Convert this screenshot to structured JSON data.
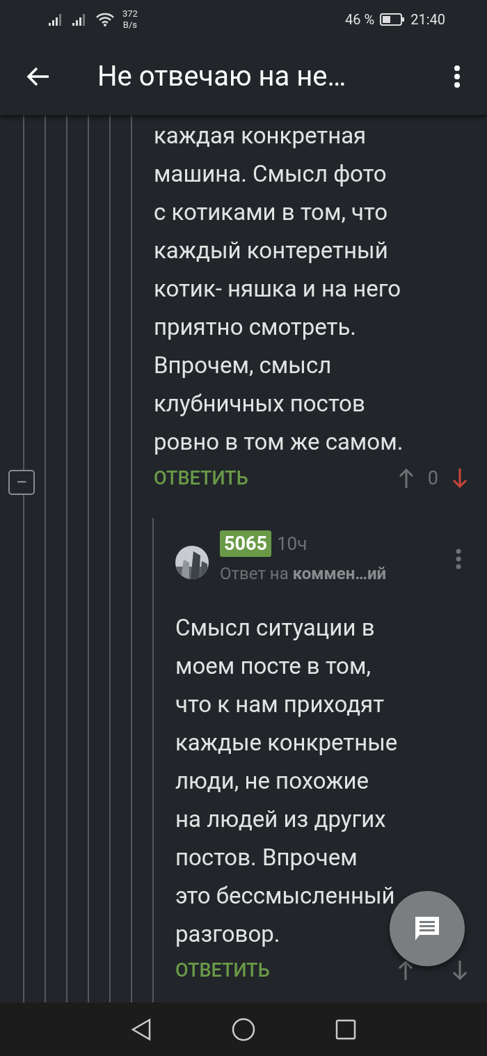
{
  "status_bar": {
    "speed_value": "372",
    "speed_unit": "B/s",
    "battery_percent": "46 %",
    "time": "21:40"
  },
  "app_bar": {
    "title": "Не отвечаю на не…"
  },
  "comments": [
    {
      "text": "каждая конкретная\nмашина. Смысл фото\nс котиками в том, что\nкаждый контеретный\nкотик- няшка и на него\nприятно смотреть.\nВпрочем, смысл\nклубничных постов\nровно в том же самом.",
      "reply_label": "ОТВЕТИТЬ",
      "score": "0",
      "downvoted": true,
      "collapse_button": "−"
    },
    {
      "rating": "5065",
      "time": "10ч",
      "reply_to_prefix": "Ответ на",
      "reply_to_target": "коммен…ий",
      "text": "Смысл ситуации в\nмоем посте в том,\nчто к нам приходят\nкаждые конкретные\nлюди, не похожие\nна людей из других\nпостов. Впрочем\nэто бессмысленный\nразговор.",
      "reply_label": "ОТВЕТИТЬ",
      "downvoted": false
    }
  ]
}
